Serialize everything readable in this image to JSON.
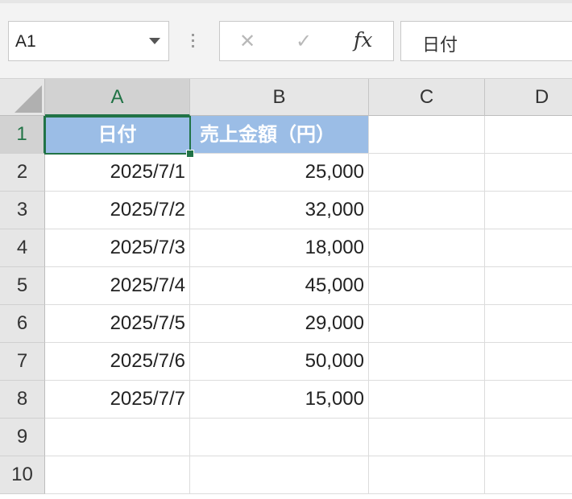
{
  "namebox": {
    "value": "A1"
  },
  "formula_bar": {
    "cancel_icon": "✕",
    "enter_icon": "✓",
    "fx_label": "fx",
    "content": "日付"
  },
  "columns": [
    "A",
    "B",
    "C",
    "D"
  ],
  "rows": [
    "1",
    "2",
    "3",
    "4",
    "5",
    "6",
    "7",
    "8",
    "9",
    "10"
  ],
  "header": {
    "a": "日付",
    "b": "売上金額（円）"
  },
  "data": [
    {
      "date": "2025/7/1",
      "amount": "25,000"
    },
    {
      "date": "2025/7/2",
      "amount": "32,000"
    },
    {
      "date": "2025/7/3",
      "amount": "18,000"
    },
    {
      "date": "2025/7/4",
      "amount": "45,000"
    },
    {
      "date": "2025/7/5",
      "amount": "29,000"
    },
    {
      "date": "2025/7/6",
      "amount": "50,000"
    },
    {
      "date": "2025/7/7",
      "amount": "15,000"
    }
  ],
  "colors": {
    "header_fill": "#9bbde6",
    "selection": "#217346"
  }
}
